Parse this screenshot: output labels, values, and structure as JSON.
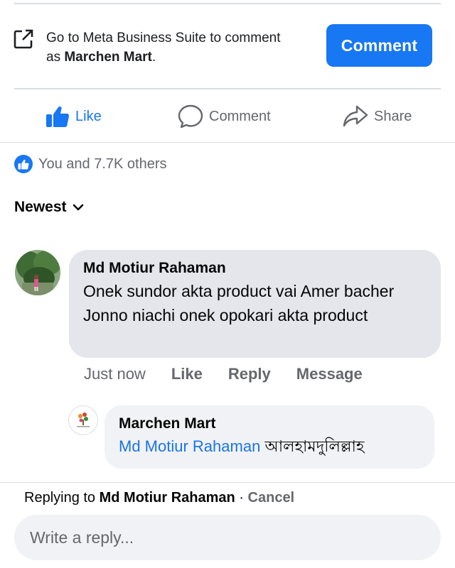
{
  "banner": {
    "line_prefix": "Go to Meta Business Suite to comment as ",
    "page_name": "Marchen Mart",
    "line_suffix": ".",
    "button_label": "Comment",
    "accent": "#1877f2"
  },
  "actions": {
    "like": "Like",
    "comment": "Comment",
    "share": "Share"
  },
  "reactions": {
    "summary": "You and 7.7K others"
  },
  "sort": {
    "label": "Newest"
  },
  "comment": {
    "author": "Md Motiur Rahaman",
    "text": "Onek sundor akta product vai  Amer bacher Jonno niachi onek opokari akta product",
    "time": "Just now",
    "like": "Like",
    "reply": "Reply",
    "message": "Message"
  },
  "reply": {
    "author": "Marchen Mart",
    "mention": "Md Motiur Rahaman",
    "text": "আলহামদুলিল্লাহ"
  },
  "composer": {
    "replying_prefix": "Replying to ",
    "replying_to": "Md Motiur Rahaman",
    "separator": " · ",
    "cancel": "Cancel",
    "placeholder": "Write a reply..."
  }
}
